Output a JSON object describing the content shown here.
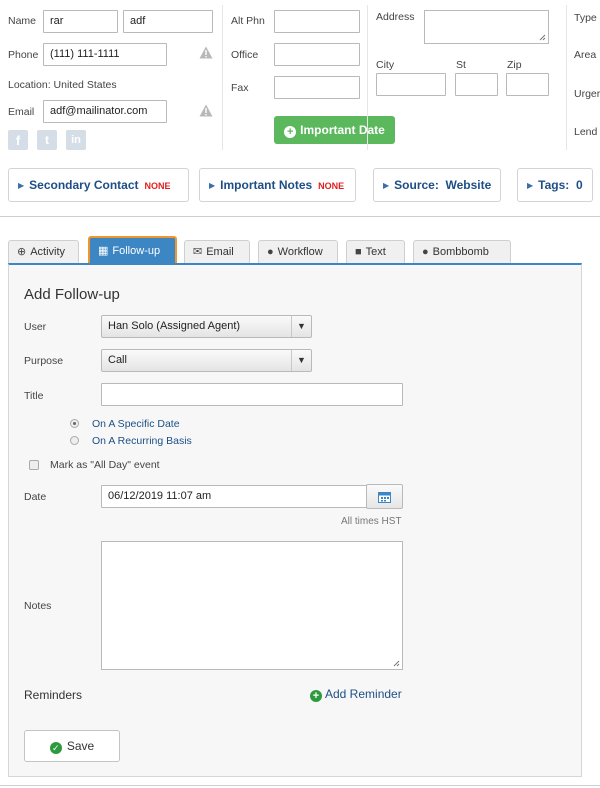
{
  "contact": {
    "name_label": "Name",
    "first_name": "rar",
    "last_name": "adf",
    "phone_label": "Phone",
    "phone": "(111) 111-1111",
    "location_label": "Location:",
    "location": "United States",
    "email_label": "Email",
    "email": "adf@mailinator.com",
    "alt_phone_label": "Alt Phn",
    "office_label": "Office",
    "fax_label": "Fax",
    "address_label": "Address",
    "city_label": "City",
    "state_label": "St",
    "zip_label": "Zip",
    "type_label": "Type",
    "area_label": "Area",
    "urgency_label": "Urger",
    "lender_label": "Lend",
    "important_date_label": "Important Date"
  },
  "collapsibles": {
    "secondary_contact": "Secondary Contact",
    "secondary_contact_status": "NONE",
    "important_notes": "Important Notes",
    "important_notes_status": "NONE",
    "source_label": "Source:",
    "source_value": "Website",
    "tags_label": "Tags:",
    "tags_count": "0"
  },
  "tabs": [
    {
      "label": "Activity",
      "icon": "plus-circle-icon"
    },
    {
      "label": "Follow-up",
      "icon": "calendar-icon",
      "active": true
    },
    {
      "label": "Email",
      "icon": "envelope-icon"
    },
    {
      "label": "Workflow",
      "icon": "drop-icon"
    },
    {
      "label": "Text",
      "icon": "chat-bubbles-icon"
    },
    {
      "label": "Bombbomb",
      "icon": "bomb-icon"
    }
  ],
  "form": {
    "heading": "Add Follow-up",
    "user_label": "User",
    "user_value": "Han Solo (Assigned Agent)",
    "purpose_label": "Purpose",
    "purpose_value": "Call",
    "title_label": "Title",
    "title_value": "",
    "radio_specific": "On A Specific Date",
    "radio_recurring": "On A Recurring Basis",
    "all_day_label": "Mark as \"All Day\" event",
    "date_label": "Date",
    "date_value": "06/12/2019 11:07 am",
    "timezone_note": "All times HST",
    "notes_label": "Notes",
    "notes_value": "",
    "reminders_label": "Reminders",
    "add_reminder": "Add Reminder",
    "save": "Save"
  },
  "colors": {
    "accent_blue": "#3c86c4",
    "active_tab_outline": "#f0962d",
    "important_date_green": "#5cb85c",
    "link_green": "#2e9a3e",
    "none_red": "#e02020"
  }
}
